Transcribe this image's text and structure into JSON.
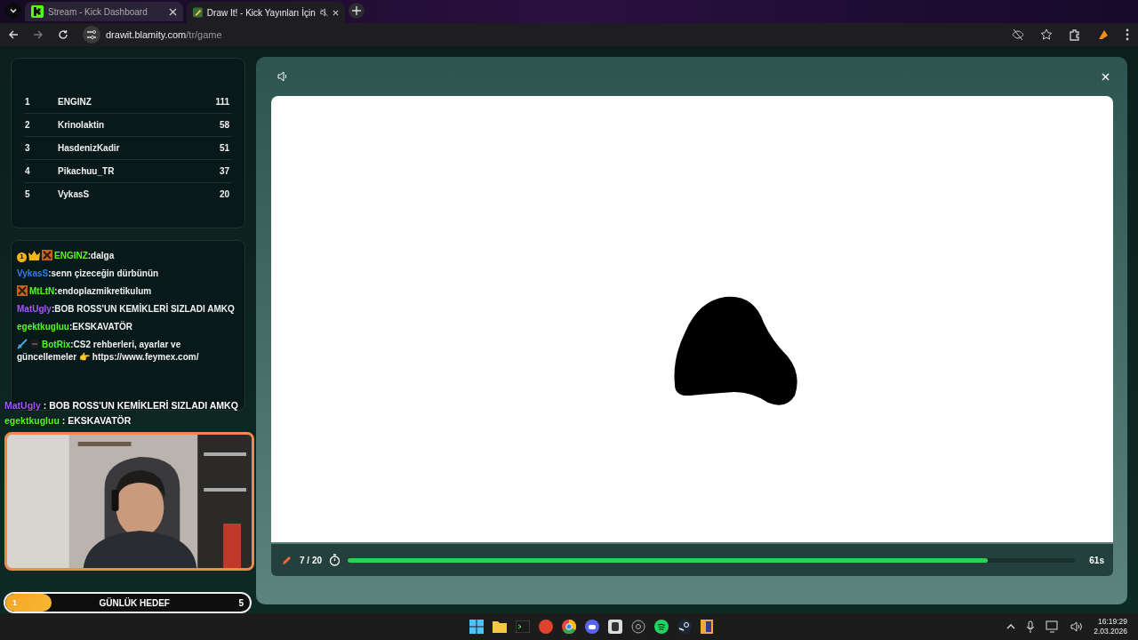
{
  "browser": {
    "tabs": [
      {
        "title": "Stream - Kick Dashboard",
        "selected": false,
        "muted": false
      },
      {
        "title": "Draw It! - Kick Yayınları İçin",
        "selected": true,
        "muted": true
      }
    ],
    "url_host": "drawit.blamity.com",
    "url_path": "/tr/game"
  },
  "leaderboard": [
    {
      "rank": "1",
      "name": "ENGINZ",
      "score": "111"
    },
    {
      "rank": "2",
      "name": "Krinolaktin",
      "score": "58"
    },
    {
      "rank": "3",
      "name": "HasdenizKadir",
      "score": "51"
    },
    {
      "rank": "4",
      "name": "Pikachuu_TR",
      "score": "37"
    },
    {
      "rank": "5",
      "name": "VykasS",
      "score": "20"
    }
  ],
  "chat": [
    {
      "badges": [
        {
          "kind": "rank",
          "text": "1"
        },
        {
          "kind": "crown"
        },
        {
          "kind": "xbox"
        }
      ],
      "user": "ENGINZ",
      "color": "#53fc18",
      "text": ":dalga"
    },
    {
      "user": "VykasS",
      "color": "#2f7fe0",
      "text": ":senn çizeceğin dürbünün"
    },
    {
      "badges": [
        {
          "kind": "xbox"
        }
      ],
      "user": "MtLtN",
      "color": "#53fc18",
      "text": ":endoplazmikretikulum"
    },
    {
      "user": "MatUgly",
      "color": "#a855f7",
      "text": ":BOB ROSS'UN KEMİKLERİ SIZLADI AMKQ"
    },
    {
      "user": "egektkugluu",
      "color": "#53fc18",
      "text": ":EKSKAVATÖR"
    },
    {
      "badges": [
        {
          "kind": "sword"
        },
        {
          "kind": "bot"
        }
      ],
      "user": "BotRix",
      "color": "#53fc18",
      "text": ":CS2 rehberleri, ayarlar ve güncellemeler 👉 https://www.feymex.com/"
    }
  ],
  "overlay_chat": [
    {
      "user": "MatUgly",
      "color": "#a855f7",
      "text": ": BOB ROSS'UN KEMİKLERİ SIZLADI AMKQ"
    },
    {
      "user": "egektkugluu",
      "color": "#53fc18",
      "text": ": EKSKAVATÖR"
    }
  ],
  "daily_goal": {
    "current": "1",
    "label": "GÜNLÜK HEDEF",
    "target": "5",
    "level": 0.19
  },
  "game": {
    "round": "7 / 20",
    "time_left": "61s",
    "timer": {
      "level": 0.88
    }
  },
  "taskbar": {
    "time": "16:19:29",
    "date": "2.03.2026"
  }
}
